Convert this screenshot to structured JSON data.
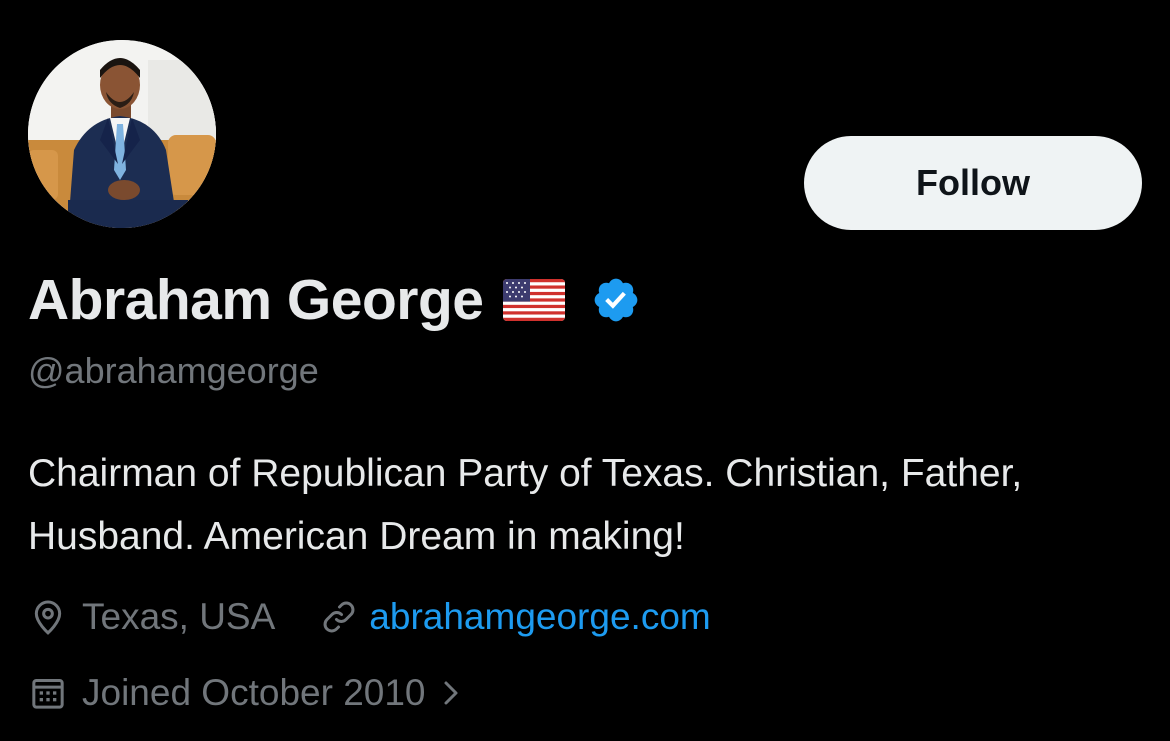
{
  "profile": {
    "display_name": "Abraham George",
    "flag_icon": "us-flag-icon",
    "verified_icon": "verified-badge-icon",
    "handle": "@abrahamgeorge",
    "bio": "Chairman of Republican Party of Texas. Christian, Father, Husband. American Dream in making!",
    "location": "Texas, USA",
    "website": "abrahamgeorge.com",
    "joined": "Joined October 2010"
  },
  "actions": {
    "follow_label": "Follow"
  },
  "colors": {
    "background": "#000000",
    "text_primary": "#e7e9ea",
    "text_secondary": "#71767b",
    "link": "#1d9bf0",
    "verified": "#1d9bf0",
    "follow_bg": "#eff3f4"
  }
}
